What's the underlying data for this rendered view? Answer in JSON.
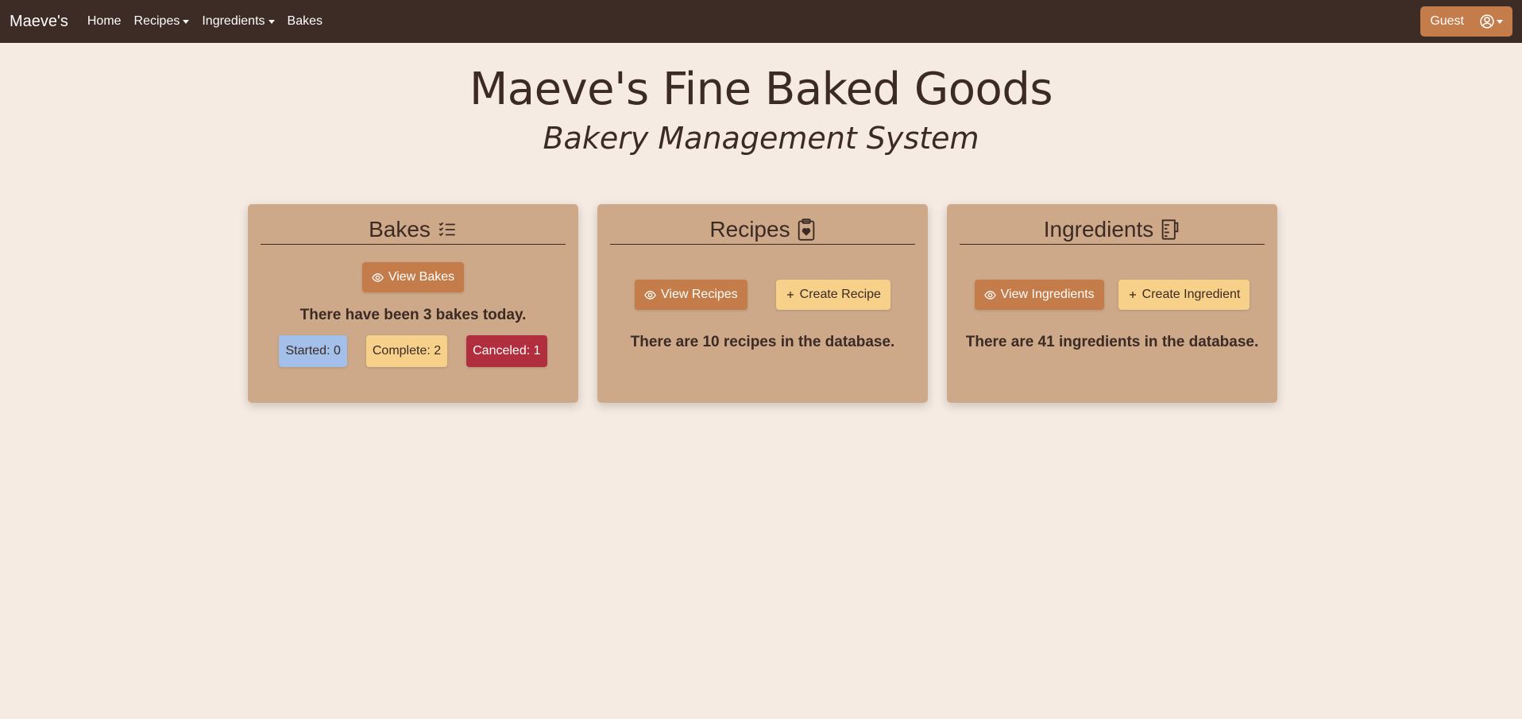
{
  "navbar": {
    "brand": "Maeve's",
    "items": [
      {
        "label": "Home",
        "dropdown": false
      },
      {
        "label": "Recipes",
        "dropdown": true
      },
      {
        "label": "Ingredients",
        "dropdown": true
      },
      {
        "label": "Bakes",
        "dropdown": false
      }
    ],
    "user_label": "Guest",
    "user_icon": "person-circle-icon"
  },
  "hero": {
    "title": "Maeve's Fine Baked Goods",
    "subtitle": "Bakery Management System"
  },
  "cards": {
    "bakes": {
      "title": "Bakes",
      "icon": "list-check-icon",
      "view_button": "View Bakes",
      "summary": "There have been 3 bakes today.",
      "badges": {
        "started": "Started: 0",
        "complete": "Complete: 2",
        "canceled": "Canceled: 1"
      }
    },
    "recipes": {
      "title": "Recipes",
      "icon": "clipboard-heart-icon",
      "view_button": "View Recipes",
      "create_button": "Create Recipe",
      "summary": "There are 10 recipes in the database."
    },
    "ingredients": {
      "title": "Ingredients",
      "icon": "measuring-cup-icon",
      "view_button": "View Ingredients",
      "create_button": "Create Ingredient",
      "summary": "There are 41 ingredients in the database."
    }
  },
  "colors": {
    "navbar_bg": "#3d2b25",
    "page_bg": "#f5ebe2",
    "card_bg": "#cda98a",
    "primary": "#c47c4a",
    "light": "#f7d08a",
    "started": "#a3c0ea",
    "canceled": "#b02e3e"
  }
}
